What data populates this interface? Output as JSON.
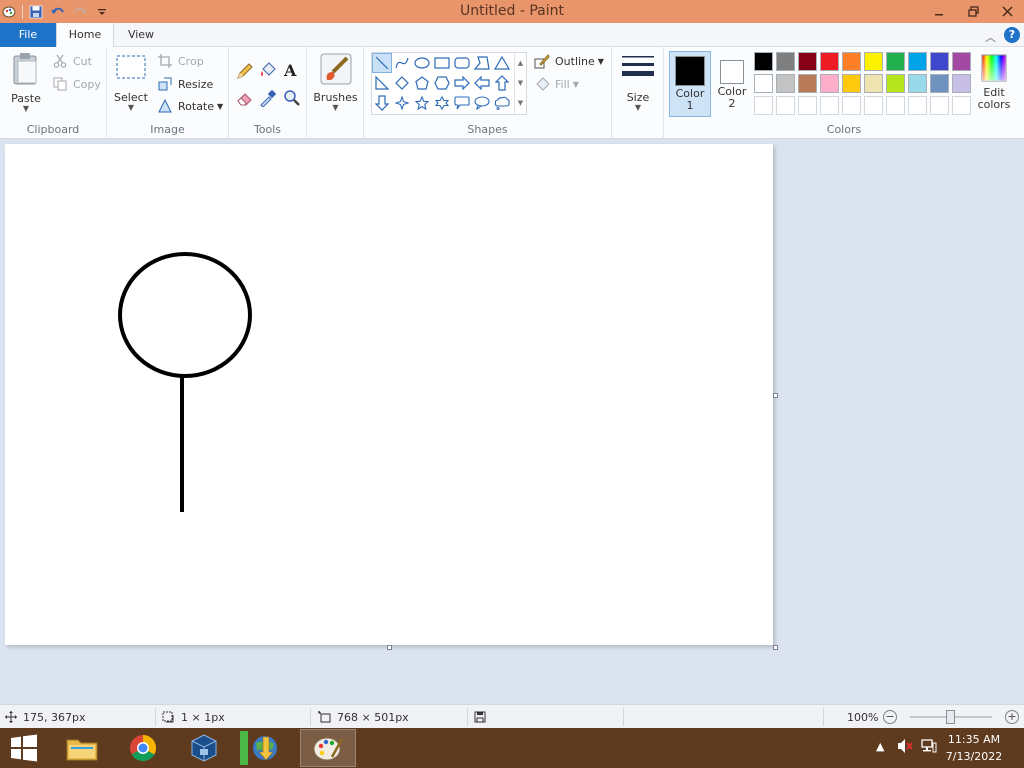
{
  "window": {
    "title": "Untitled - Paint"
  },
  "tabs": {
    "file": "File",
    "home": "Home",
    "view": "View"
  },
  "clipboard": {
    "paste": "Paste",
    "cut": "Cut",
    "copy": "Copy",
    "label": "Clipboard"
  },
  "image": {
    "select": "Select",
    "crop": "Crop",
    "resize": "Resize",
    "rotate": "Rotate",
    "label": "Image"
  },
  "tools": {
    "label": "Tools"
  },
  "brushes": {
    "label": "Brushes"
  },
  "shapes": {
    "label": "Shapes",
    "outline": "Outline",
    "fill": "Fill"
  },
  "size": {
    "label": "Size"
  },
  "color1": {
    "line1": "Color",
    "line2": "1",
    "value": "#000000"
  },
  "color2": {
    "line1": "Color",
    "line2": "2",
    "value": "#ffffff"
  },
  "colors": {
    "label": "Colors",
    "edit_line1": "Edit",
    "edit_line2": "colors",
    "row1": [
      "#000000",
      "#7f7f7f",
      "#880015",
      "#ed1c24",
      "#ff7f27",
      "#fff200",
      "#22b14c",
      "#00a2e8",
      "#3f48cc",
      "#a349a4"
    ],
    "row2": [
      "#ffffff",
      "#c3c3c3",
      "#b97a57",
      "#ffaec9",
      "#ffc90e",
      "#efe4b0",
      "#b5e61d",
      "#99d9ea",
      "#7092be",
      "#c8bfe7"
    ]
  },
  "status": {
    "cursor_pos": "175, 367px",
    "selection_size": "1 × 1px",
    "canvas_size": "768 × 501px",
    "zoom": "100%"
  },
  "taskbar": {
    "time": "11:35 AM",
    "date": "7/13/2022"
  }
}
